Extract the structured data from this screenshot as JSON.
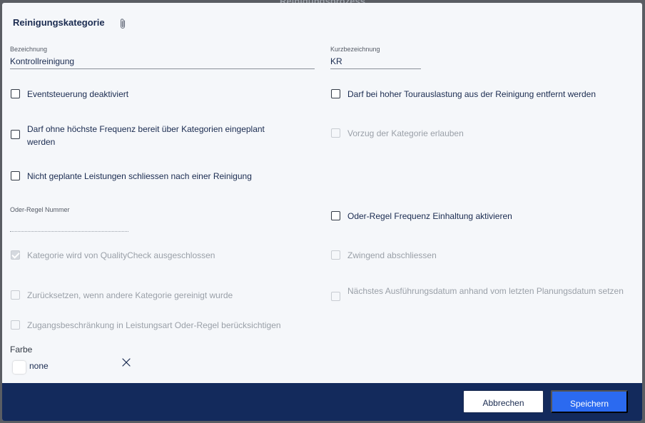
{
  "backdrop": {
    "title": "Reinigungsprozess"
  },
  "dialog": {
    "title": "Reinigungskategorie",
    "attachment_icon": "paperclip-icon"
  },
  "fields": {
    "bezeichnung": {
      "label": "Bezeichnung",
      "value": "Kontrollreinigung"
    },
    "kurzbezeichnung": {
      "label": "Kurzbezeichnung",
      "value": "KR"
    },
    "oder_regel_nummer": {
      "label": "Oder-Regel Nummer",
      "value": ""
    }
  },
  "checkboxes": {
    "eventsteuerung": {
      "label": "Eventsteuerung deaktiviert",
      "checked": false,
      "disabled": false
    },
    "tourauslastung": {
      "label": "Darf bei hoher Tourauslastung aus der Reinigung entfernt werden",
      "checked": false,
      "disabled": false
    },
    "ohne_frequenz": {
      "label": "Darf ohne höchste Frequenz bereit über Kategorien eingeplant werden",
      "checked": false,
      "disabled": false
    },
    "vorzug": {
      "label": "Vorzug der Kategorie erlauben",
      "checked": false,
      "disabled": true
    },
    "nicht_geplant": {
      "label": "Nicht geplante Leistungen schliessen nach einer Reinigung",
      "checked": false,
      "disabled": false
    },
    "oder_regel_frequenz": {
      "label": "Oder-Regel Frequenz Einhaltung aktivieren",
      "checked": false,
      "disabled": false
    },
    "qualitycheck": {
      "label": "Kategorie wird von QualityCheck ausgeschlossen",
      "checked": true,
      "disabled": true
    },
    "zwingend": {
      "label": "Zwingend abschliessen",
      "checked": false,
      "disabled": true
    },
    "zuruecksetzen": {
      "label": "Zurücksetzen, wenn andere Kategorie gereinigt wurde",
      "checked": false,
      "disabled": true
    },
    "naechstes_datum": {
      "label": "Nächstes Ausführungsdatum anhand vom letzten Planungsdatum setzen",
      "checked": false,
      "disabled": true
    },
    "zugangsbeschraenkung": {
      "label": "Zugangsbeschränkung in Leistungsart Oder-Regel berücksichtigen",
      "checked": false,
      "disabled": true
    }
  },
  "farbe": {
    "label": "Farbe",
    "value": "none",
    "swatch_color": "#ffffff",
    "clear_icon": "close-icon"
  },
  "footer": {
    "cancel_label": "Abbrechen",
    "save_label": "Speichern"
  },
  "colors": {
    "footer_bg": "#132a5c",
    "primary": "#2b6af0",
    "text": "#1a2b50"
  }
}
